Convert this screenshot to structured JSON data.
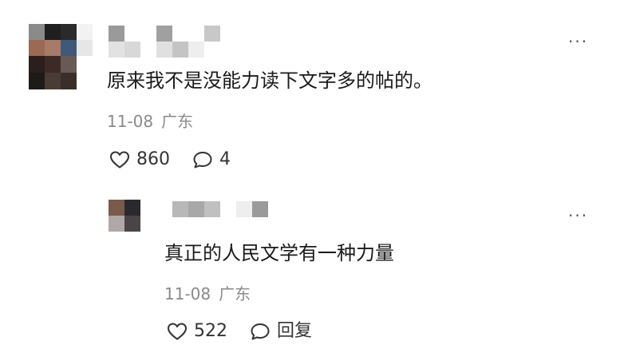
{
  "comment": {
    "more_glyph": "···",
    "text": "原来我不是没能力读下文字多的帖的。",
    "date": "11-08",
    "location": "广东",
    "like_count": "860",
    "reply_count": "4",
    "avatar_pixels": [
      "#8a8a8a",
      "#1f1f1f",
      "#2a2a2a",
      "#f2f2f2",
      "#9a6a55",
      "#a87a6a",
      "#3e5a78",
      "#e6e6e6",
      "#2a1f1c",
      "#3b2a26",
      "#6a5a55",
      "#ffffff",
      "#1e1a18",
      "#4a3c34",
      "#3a2e2a",
      "#ffffff"
    ],
    "name_pixels": [
      "#9a9a9a",
      "#ffffff",
      "#ffffff",
      "#a0a0a0",
      "#ffffff",
      "#ffffff",
      "#c8c8c8",
      "#e2e2e2",
      "#d8d8d8",
      "#ffffff",
      "#e0e0e0",
      "#c4c4c4",
      "#eeeeee",
      "#ffffff"
    ]
  },
  "reply": {
    "more_glyph": "···",
    "text": "真正的人民文学有一种力量",
    "date": "11-08",
    "location": "广东",
    "like_count": "522",
    "reply_label": "回复",
    "avatar_pixels": [
      "#7a5a4a",
      "#2a2a2e",
      "#b0a8a6",
      "#4a4446"
    ],
    "name_pixels": [
      "#b8b8b8",
      "#a8a8a8",
      "#c0c0c0",
      "#ffffff",
      "#eeeeee",
      "#9a9a9a"
    ]
  },
  "icons": {
    "like": "heart-outline-icon",
    "comment": "speech-bubble-icon"
  }
}
